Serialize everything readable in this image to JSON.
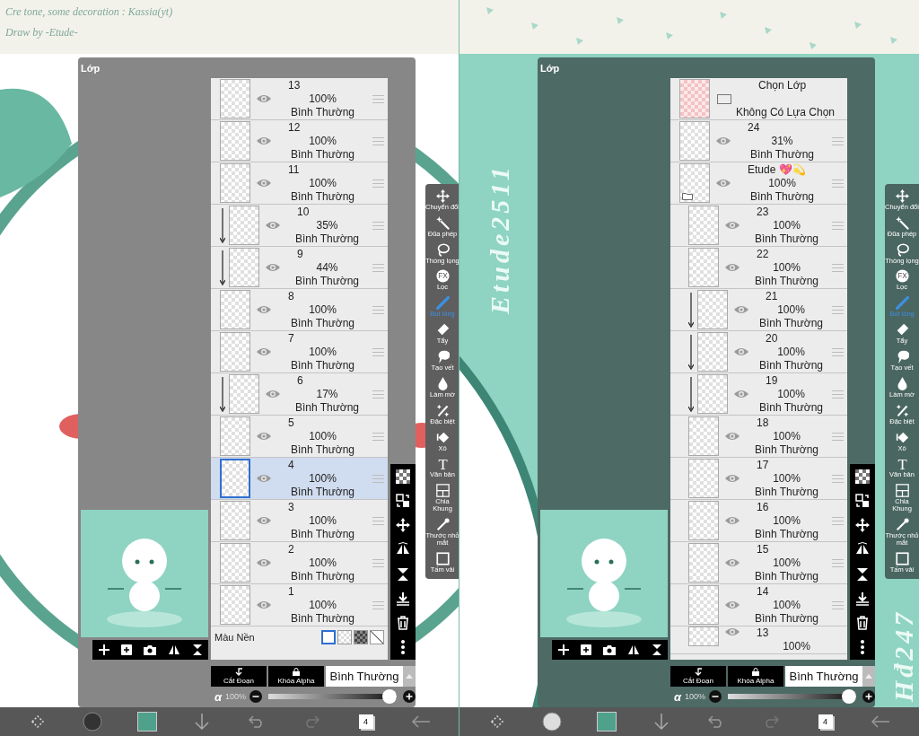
{
  "panels": [
    {
      "caption": [
        "Cre tone, some decoration : Kassia(yt)",
        "Draw by -Etude-"
      ],
      "layers_title": "Lớp",
      "layers": [
        {
          "kind": "layer",
          "name": "13",
          "opacity": "100%",
          "blend": "Bình Thường",
          "selected": false,
          "clipped": false
        },
        {
          "kind": "layer",
          "name": "12",
          "opacity": "100%",
          "blend": "Bình Thường",
          "selected": false,
          "clipped": false
        },
        {
          "kind": "layer",
          "name": "11",
          "opacity": "100%",
          "blend": "Bình Thường",
          "selected": false,
          "clipped": false
        },
        {
          "kind": "layer",
          "name": "10",
          "opacity": "35%",
          "blend": "Bình Thường",
          "selected": false,
          "clipped": true
        },
        {
          "kind": "layer",
          "name": "9",
          "opacity": "44%",
          "blend": "Bình Thường",
          "selected": false,
          "clipped": true
        },
        {
          "kind": "layer",
          "name": "8",
          "opacity": "100%",
          "blend": "Bình Thường",
          "selected": false,
          "clipped": false
        },
        {
          "kind": "layer",
          "name": "7",
          "opacity": "100%",
          "blend": "Bình Thường",
          "selected": false,
          "clipped": false
        },
        {
          "kind": "layer",
          "name": "6",
          "opacity": "17%",
          "blend": "Bình Thường",
          "selected": false,
          "clipped": true
        },
        {
          "kind": "layer",
          "name": "5",
          "opacity": "100%",
          "blend": "Bình Thường",
          "selected": false,
          "clipped": false
        },
        {
          "kind": "layer",
          "name": "4",
          "opacity": "100%",
          "blend": "Bình Thường",
          "selected": true,
          "clipped": false
        },
        {
          "kind": "layer",
          "name": "3",
          "opacity": "100%",
          "blend": "Bình Thường",
          "selected": false,
          "clipped": false
        },
        {
          "kind": "layer",
          "name": "2",
          "opacity": "100%",
          "blend": "Bình Thường",
          "selected": false,
          "clipped": false
        },
        {
          "kind": "layer",
          "name": "1",
          "opacity": "100%",
          "blend": "Bình Thường",
          "selected": false,
          "clipped": false
        },
        {
          "kind": "background",
          "name": "Màu Nền",
          "swatches": [
            {
              "kind": "white",
              "selected": true
            },
            {
              "kind": "checker",
              "selected": false
            },
            {
              "kind": "dark-checker",
              "selected": false
            },
            {
              "kind": "none",
              "selected": false
            }
          ]
        }
      ],
      "clip_button": "Cắt Đoạn",
      "alpha_lock_button": "Khóa Alpha",
      "blend_mode": "Bình Thường",
      "alpha_symbol": "α",
      "alpha_value": "100%",
      "alpha_slider": {
        "level": 1
      },
      "tools": [
        {
          "label": "Chuyển đổi",
          "selected": false
        },
        {
          "label": "Đũa phép",
          "selected": false
        },
        {
          "label": "Thòng lọng",
          "selected": false
        },
        {
          "label": "Lọc",
          "selected": false,
          "badge": "FX"
        },
        {
          "label": "Bút lông",
          "selected": true
        },
        {
          "label": "Tẩy",
          "selected": false
        },
        {
          "label": "Tạo vết",
          "selected": false
        },
        {
          "label": "Làm mờ",
          "selected": false
        },
        {
          "label": "Đặc biệt",
          "selected": false
        },
        {
          "label": "Xô",
          "selected": false
        },
        {
          "label": "Văn bản",
          "selected": false,
          "badge": "T"
        },
        {
          "label": "Chia Khung",
          "selected": false
        },
        {
          "label": "Thước nhỏ mắt",
          "selected": false
        },
        {
          "label": "Tấm vải",
          "selected": false
        }
      ],
      "layer_count": "4"
    },
    {
      "watermarks": [
        "Etude2511",
        "Hđ247"
      ],
      "layers_title": "Lớp",
      "layers": [
        {
          "kind": "selection",
          "name": "Chọn Lớp",
          "status": "Không Có Lựa Chọn"
        },
        {
          "kind": "layer",
          "name": "24",
          "opacity": "31%",
          "blend": "Bình Thường",
          "selected": false,
          "clipped": false
        },
        {
          "kind": "folder",
          "name": "Etude 💖💫",
          "opacity": "100%",
          "blend": "Bình Thường",
          "selected": false,
          "clipped": false,
          "children": [
            {
              "kind": "layer",
              "name": "23",
              "opacity": "100%",
              "blend": "Bình Thường",
              "selected": false,
              "clipped": false
            },
            {
              "kind": "layer",
              "name": "22",
              "opacity": "100%",
              "blend": "Bình Thường",
              "selected": false,
              "clipped": false
            },
            {
              "kind": "layer",
              "name": "21",
              "opacity": "100%",
              "blend": "Bình Thường",
              "selected": false,
              "clipped": true
            },
            {
              "kind": "layer",
              "name": "20",
              "opacity": "100%",
              "blend": "Bình Thường",
              "selected": false,
              "clipped": true
            },
            {
              "kind": "layer",
              "name": "19",
              "opacity": "100%",
              "blend": "Bình Thường",
              "selected": false,
              "clipped": true
            },
            {
              "kind": "layer",
              "name": "18",
              "opacity": "100%",
              "blend": "Bình Thường",
              "selected": false,
              "clipped": false
            },
            {
              "kind": "layer",
              "name": "17",
              "opacity": "100%",
              "blend": "Bình Thường",
              "selected": false,
              "clipped": false
            },
            {
              "kind": "layer",
              "name": "16",
              "opacity": "100%",
              "blend": "Bình Thường",
              "selected": false,
              "clipped": false
            },
            {
              "kind": "layer",
              "name": "15",
              "opacity": "100%",
              "blend": "Bình Thường",
              "selected": false,
              "clipped": false
            },
            {
              "kind": "layer",
              "name": "14",
              "opacity": "100%",
              "blend": "Bình Thường",
              "selected": false,
              "clipped": false
            },
            {
              "kind": "layer",
              "name": "13",
              "opacity": "100%",
              "selected": false,
              "clipped": false
            }
          ]
        }
      ],
      "clip_button": "Cắt Đoạn",
      "alpha_lock_button": "Khóa Alpha",
      "blend_mode": "Bình Thường",
      "alpha_symbol": "α",
      "alpha_value": "100%",
      "alpha_slider": {
        "level": 1
      },
      "tools": [
        {
          "label": "Chuyển đổi",
          "selected": false
        },
        {
          "label": "Đũa phép",
          "selected": false
        },
        {
          "label": "Thòng lọng",
          "selected": false
        },
        {
          "label": "Lọc",
          "selected": false,
          "badge": "FX"
        },
        {
          "label": "Bút lông",
          "selected": true
        },
        {
          "label": "Tẩy",
          "selected": false
        },
        {
          "label": "Tạo vết",
          "selected": false
        },
        {
          "label": "Làm mờ",
          "selected": false
        },
        {
          "label": "Đặc biệt",
          "selected": false
        },
        {
          "label": "Xô",
          "selected": false
        },
        {
          "label": "Văn bản",
          "selected": false,
          "badge": "T"
        },
        {
          "label": "Chia Khung",
          "selected": false
        },
        {
          "label": "Thước nhỏ mắt",
          "selected": false
        },
        {
          "label": "Tấm vải",
          "selected": false
        }
      ],
      "layer_count": "4"
    }
  ]
}
